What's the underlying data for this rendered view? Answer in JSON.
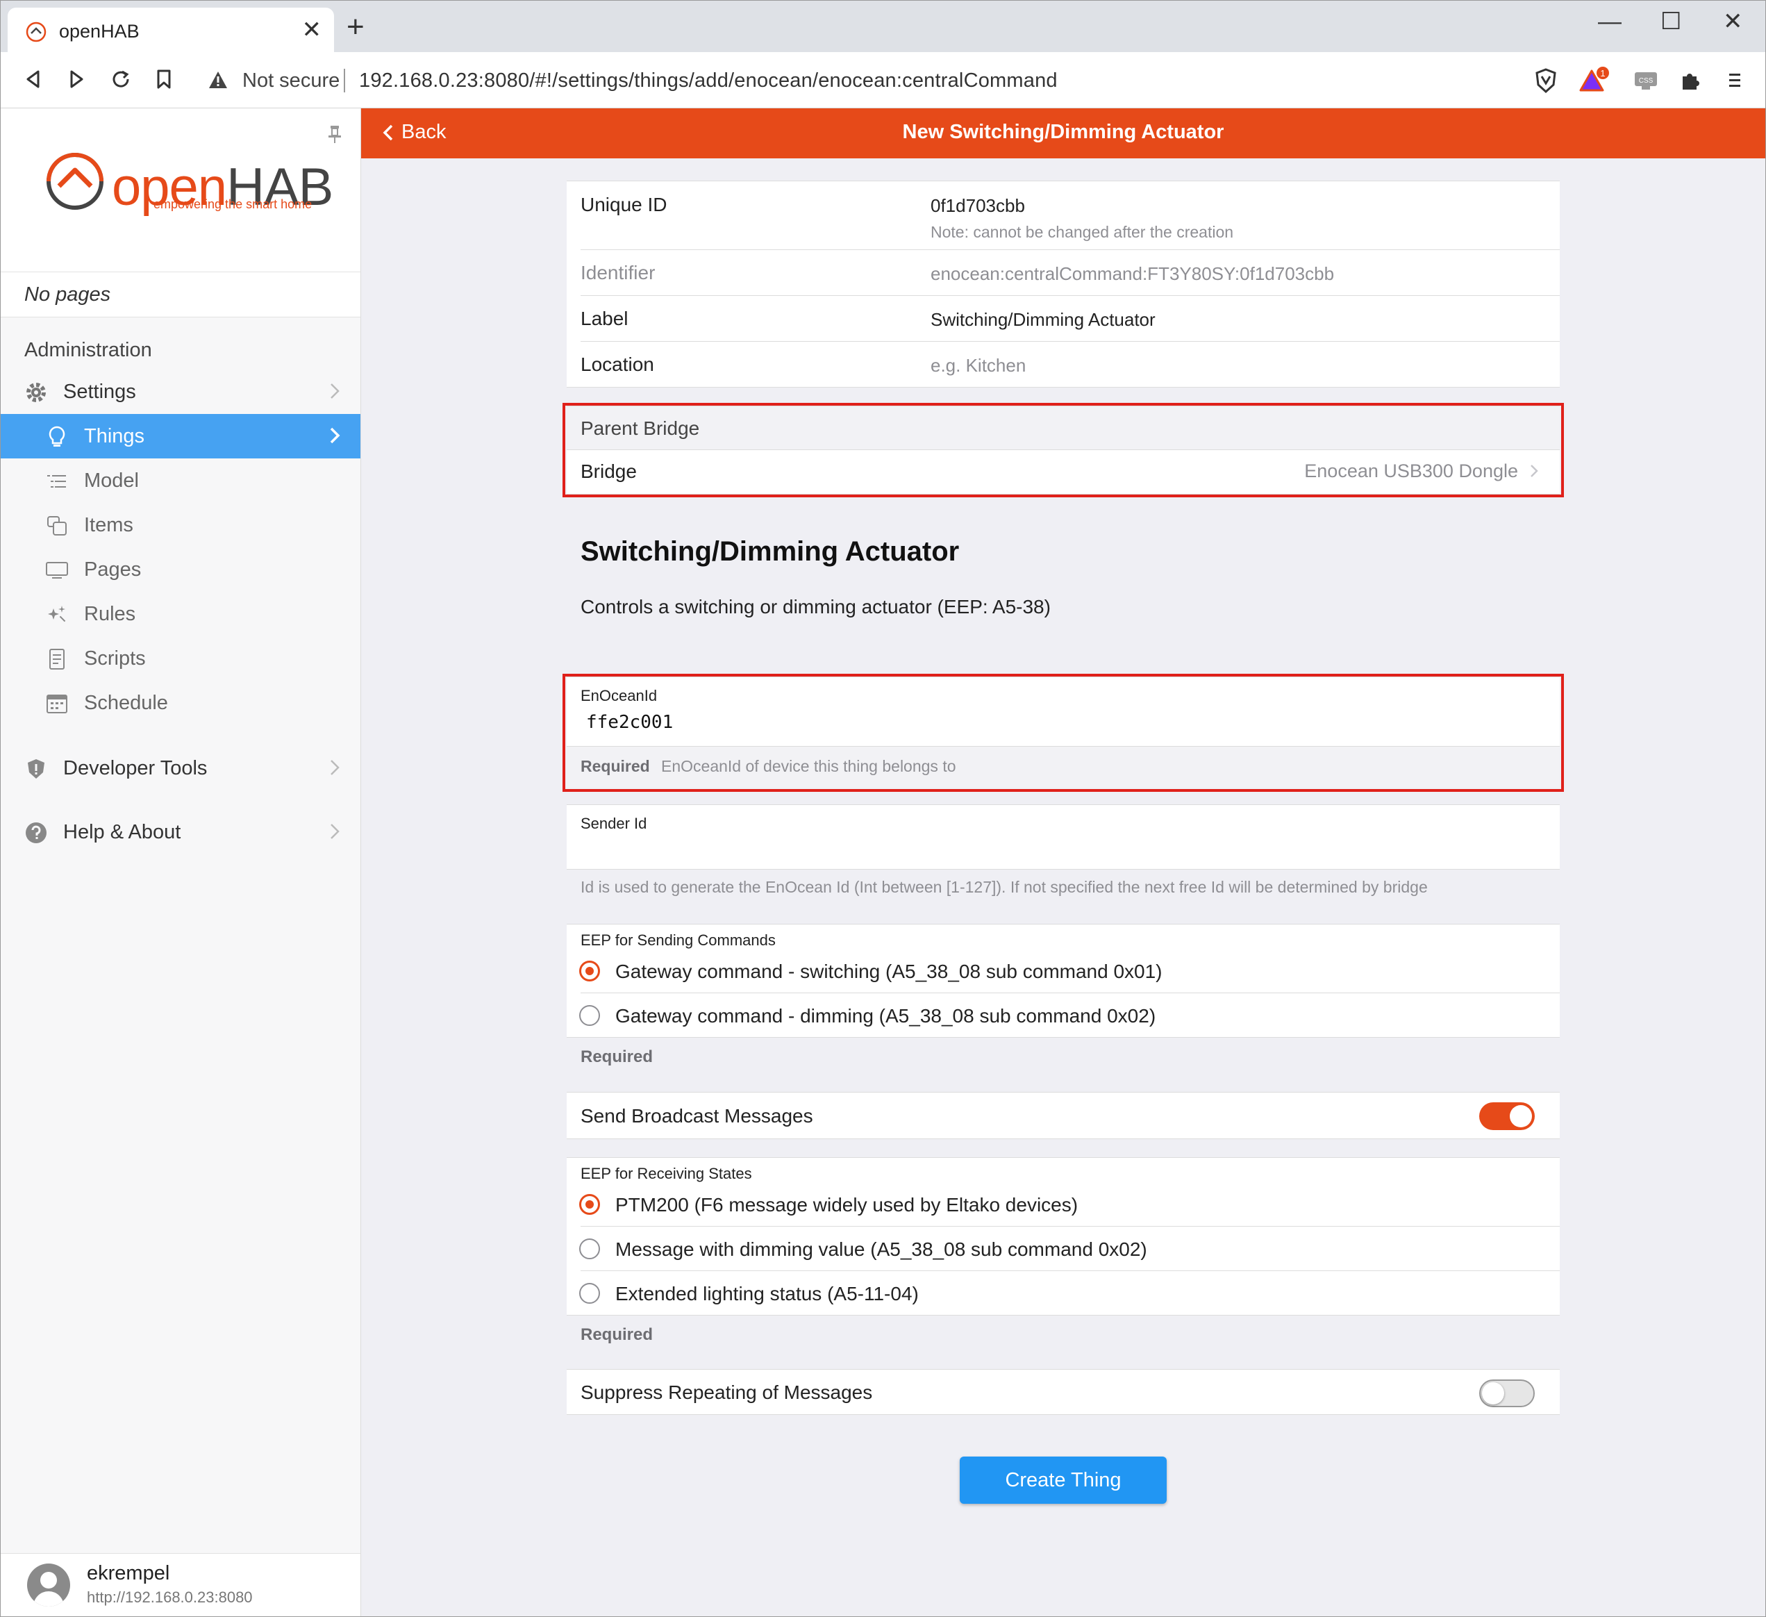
{
  "browser": {
    "tab_title": "openHAB",
    "not_secure": "Not secure",
    "url": "192.168.0.23:8080/#!/settings/things/add/enocean/enocean:centralCommand",
    "ext_badge": "1",
    "ext_css_label": "CSS"
  },
  "sidebar": {
    "logo_open": "open",
    "logo_hab": "HAB",
    "logo_tagline": "empowering the smart home",
    "no_pages": "No pages",
    "section_title": "Administration",
    "settings": "Settings",
    "items": [
      {
        "label": "Things",
        "icon": "lightbulb-icon",
        "active": true
      },
      {
        "label": "Model",
        "icon": "list-indent-icon"
      },
      {
        "label": "Items",
        "icon": "items-icon"
      },
      {
        "label": "Pages",
        "icon": "monitor-icon"
      },
      {
        "label": "Rules",
        "icon": "sparkle-icon"
      },
      {
        "label": "Scripts",
        "icon": "document-icon"
      },
      {
        "label": "Schedule",
        "icon": "calendar-icon"
      }
    ],
    "developer_tools": "Developer Tools",
    "help_about": "Help & About",
    "user_name": "ekrempel",
    "user_url": "http://192.168.0.23:8080"
  },
  "navbar": {
    "back": "Back",
    "title": "New Switching/Dimming Actuator",
    "color": "#e64a19"
  },
  "form": {
    "unique_id_label": "Unique ID",
    "unique_id_value": "0f1d703cbb",
    "unique_id_note": "Note: cannot be changed after the creation",
    "identifier_label": "Identifier",
    "identifier_value": "enocean:centralCommand:FT3Y80SY:0f1d703cbb",
    "label_label": "Label",
    "label_value": "Switching/Dimming Actuator",
    "location_label": "Location",
    "location_placeholder": "e.g. Kitchen",
    "parent_bridge_title": "Parent Bridge",
    "bridge_label": "Bridge",
    "bridge_value": "Enocean USB300 Dongle"
  },
  "thing_type": {
    "title": "Switching/Dimming Actuator",
    "description": "Controls a switching or dimming actuator (EEP: A5-38)"
  },
  "config": {
    "enocean_id_label": "EnOceanId",
    "enocean_id_value": "ffe2c001",
    "enocean_id_required": "Required",
    "enocean_id_help": "EnOceanId of device this thing belongs to",
    "sender_id_label": "Sender Id",
    "sender_id_value": "",
    "sender_id_help": "Id is used to generate the EnOcean Id (Int between [1-127]). If not specified the next free Id will be determined by bridge",
    "send_eep_label": "EEP for Sending Commands",
    "send_eep_options": [
      {
        "label": "Gateway command - switching (A5_38_08 sub command 0x01)",
        "selected": true
      },
      {
        "label": "Gateway command - dimming (A5_38_08 sub command 0x02)",
        "selected": false
      }
    ],
    "send_eep_required": "Required",
    "broadcast_label": "Send Broadcast Messages",
    "broadcast_on": true,
    "receive_eep_label": "EEP for Receiving States",
    "receive_eep_options": [
      {
        "label": "PTM200 (F6 message widely used by Eltako devices)",
        "selected": true
      },
      {
        "label": "Message with dimming value (A5_38_08 sub command 0x02)",
        "selected": false
      },
      {
        "label": "Extended lighting status (A5-11-04)",
        "selected": false
      }
    ],
    "receive_eep_required": "Required",
    "suppress_label": "Suppress Repeating of Messages",
    "suppress_on": false
  },
  "create_button": "Create Thing",
  "colors": {
    "accent": "#e64a19",
    "active_nav": "#46a2f2",
    "button": "#2196f3",
    "highlight_box": "#e0201a"
  }
}
